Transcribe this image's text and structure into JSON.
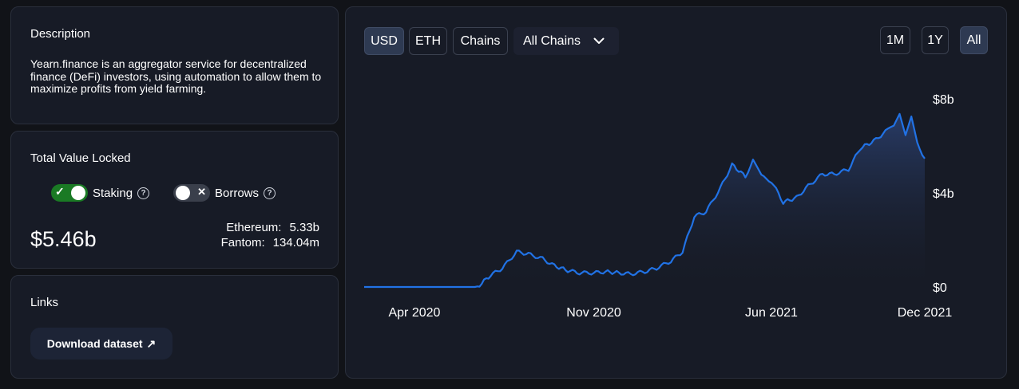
{
  "description": {
    "title": "Description",
    "text": "Yearn.finance is an aggregator service for decentralized finance (DeFi) investors, using automation to allow them to maximize profits from yield farming."
  },
  "tvl": {
    "title": "Total Value Locked",
    "staking_label": "Staking",
    "staking_on": true,
    "borrows_label": "Borrows",
    "borrows_on": false,
    "value": "$5.46b",
    "chains": [
      {
        "name": "Ethereum:",
        "value": "5.33b"
      },
      {
        "name": "Fantom:",
        "value": "134.04m"
      }
    ]
  },
  "links": {
    "title": "Links",
    "download_label": "Download dataset",
    "download_icon": "arrow-up-right-icon"
  },
  "controls": {
    "usd": "USD",
    "eth": "ETH",
    "chains": "Chains",
    "chain_select": "All Chains",
    "range_1m": "1M",
    "range_1y": "1Y",
    "range_all": "All",
    "active_denomination": "USD",
    "active_range": "All"
  },
  "colors": {
    "line": "#2172e5",
    "active_toggle": "#1a7a24"
  },
  "chart_data": {
    "type": "area",
    "x_tick_labels": [
      "Apr 2020",
      "Nov 2020",
      "Jun 2021",
      "Dec 2021"
    ],
    "y_tick_labels": [
      "$0",
      "$4b",
      "$8b"
    ],
    "ylim": [
      0,
      8
    ],
    "y_unit": "billion USD",
    "grid": false,
    "legend": "none",
    "x": [
      "2020-02-01",
      "2020-03-01",
      "2020-04-01",
      "2020-05-01",
      "2020-06-01",
      "2020-06-15",
      "2020-07-01",
      "2020-07-15",
      "2020-08-01",
      "2020-08-15",
      "2020-09-01",
      "2020-09-15",
      "2020-10-01",
      "2020-10-15",
      "2020-11-01",
      "2020-11-15",
      "2020-12-01",
      "2020-12-15",
      "2021-01-01",
      "2021-01-15",
      "2021-02-01",
      "2021-02-15",
      "2021-03-01",
      "2021-03-15",
      "2021-04-01",
      "2021-04-15",
      "2021-05-01",
      "2021-05-10",
      "2021-05-20",
      "2021-06-01",
      "2021-06-15",
      "2021-07-01",
      "2021-07-15",
      "2021-08-01",
      "2021-08-15",
      "2021-09-01",
      "2021-09-15",
      "2021-10-01",
      "2021-10-15",
      "2021-10-25",
      "2021-11-01",
      "2021-11-08",
      "2021-11-15",
      "2021-11-22",
      "2021-12-01"
    ],
    "values": [
      0.0,
      0.0,
      0.0,
      0.0,
      0.0,
      0.0,
      0.5,
      0.8,
      1.5,
      1.4,
      1.2,
      0.9,
      0.7,
      0.6,
      0.6,
      0.65,
      0.6,
      0.55,
      0.65,
      0.8,
      1.1,
      1.5,
      3.0,
      3.2,
      4.2,
      5.2,
      4.7,
      5.4,
      4.7,
      4.5,
      3.6,
      3.8,
      4.3,
      4.8,
      4.8,
      5.0,
      5.9,
      6.2,
      6.6,
      6.8,
      7.3,
      6.4,
      7.2,
      6.1,
      5.46
    ]
  }
}
